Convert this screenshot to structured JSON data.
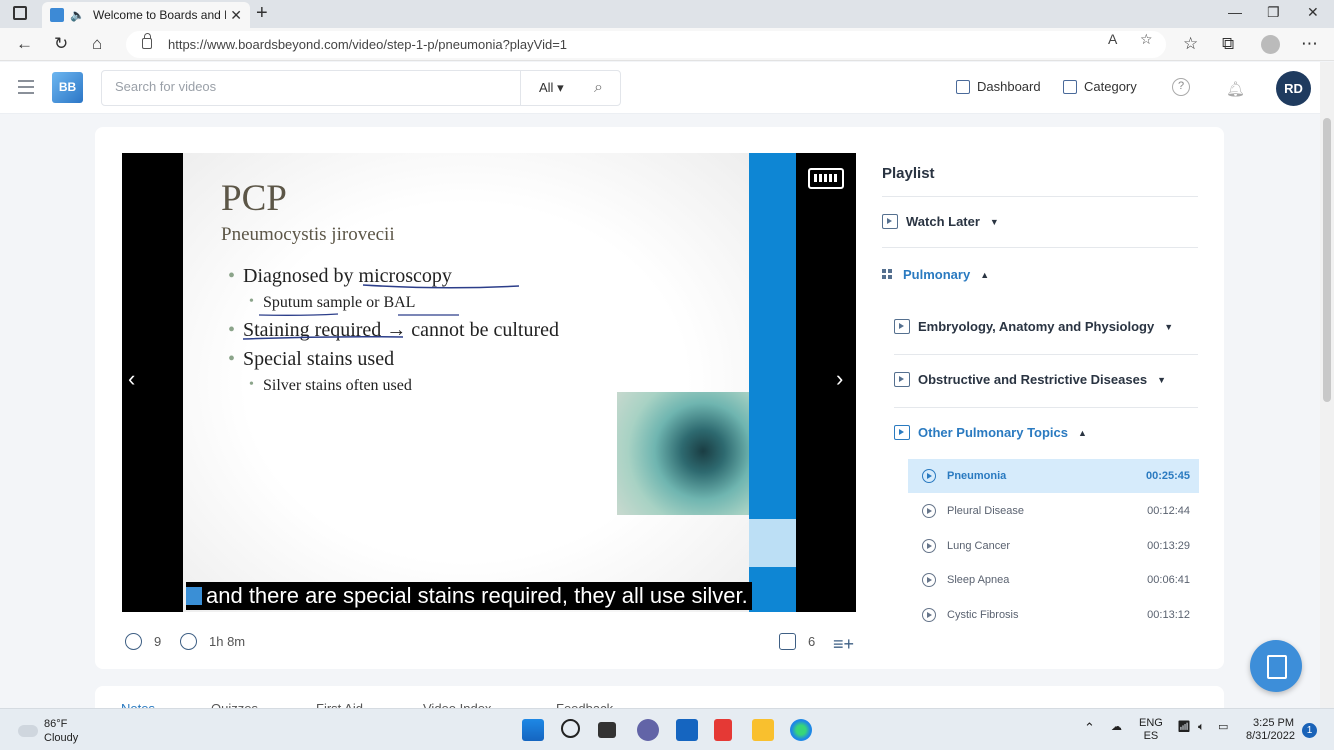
{
  "browser": {
    "tab_title": "Welcome to Boards and Be",
    "url": "https://www.boardsbeyond.com/video/step-1-p/pneumonia?playVid=1"
  },
  "header": {
    "search_placeholder": "Search for videos",
    "search_filter": "All",
    "dashboard": "Dashboard",
    "category": "Category",
    "help": "?",
    "avatar": "RD"
  },
  "slide": {
    "title": "PCP",
    "subtitle": "Pneumocystis jirovecii",
    "bullets": {
      "b1": "Diagnosed by microscopy",
      "b1a": "Sputum sample or BAL",
      "b2": "Staining required → cannot be cultured",
      "b3": "Special stains used",
      "b3a": "Silver stains often used"
    },
    "caption": "and there are special stains required, they all use silver."
  },
  "video_stats": {
    "views": "9",
    "duration": "1h 8m",
    "questions": "6"
  },
  "playlist": {
    "title": "Playlist",
    "watch_later": "Watch Later",
    "pulmonary": "Pulmonary",
    "sections": {
      "embryology": "Embryology, Anatomy and Physiology",
      "obstructive": "Obstructive and Restrictive Diseases",
      "other": "Other Pulmonary Topics"
    },
    "videos": [
      {
        "name": "Pneumonia",
        "time": "00:25:45"
      },
      {
        "name": "Pleural Disease",
        "time": "00:12:44"
      },
      {
        "name": "Lung Cancer",
        "time": "00:13:29"
      },
      {
        "name": "Sleep Apnea",
        "time": "00:06:41"
      },
      {
        "name": "Cystic Fibrosis",
        "time": "00:13:12"
      }
    ]
  },
  "lower_tabs": [
    "Notes",
    "Quizzes",
    "First Aid",
    "Video Index",
    "Feedback"
  ],
  "taskbar": {
    "temp": "86°F",
    "weather": "Cloudy",
    "lang1": "ENG",
    "lang2": "ES",
    "time": "3:25 PM",
    "date": "8/31/2022",
    "notifications": "1"
  },
  "colors": {
    "accent": "#2a7ac0",
    "avatar_bg": "#1f3b5f",
    "video_blue": "#0e86d4"
  }
}
